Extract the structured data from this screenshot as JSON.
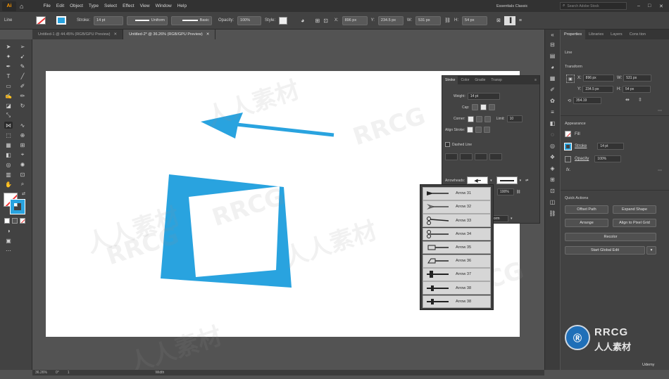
{
  "app": {
    "logo": "Ai",
    "workspace": "Essentials Classic",
    "search_placeholder": "Search Adobe Stock"
  },
  "menu": [
    "File",
    "Edit",
    "Object",
    "Type",
    "Select",
    "Effect",
    "View",
    "Window",
    "Help"
  ],
  "control_bar": {
    "stroke_label": "Stroke:",
    "stroke_value": "14 pt",
    "profile_value": "Uniform",
    "brush_value": "Basic",
    "opacity_label": "Opacity:",
    "opacity_value": "100%",
    "style_label": "Style:",
    "x_label": "X:",
    "x_value": "896 px",
    "y_label": "Y:",
    "y_value": "234.5 px",
    "w_label": "W:",
    "w_value": "531 px",
    "h_label": "H:",
    "h_value": "54 px",
    "line_label": "Line"
  },
  "tabs": [
    {
      "label": "Untitled-1 @ 44.45% (RGB/GPU Preview)",
      "active": false
    },
    {
      "label": "Untitled-2* @ 36.26% (RGB/GPU Preview)",
      "active": true
    }
  ],
  "stroke_panel": {
    "tabs": [
      "Stroke",
      "Color",
      "Gradie",
      "Transp"
    ],
    "weight_label": "Weight:",
    "weight_value": "14 pt",
    "cap_label": "Cap:",
    "corner_label": "Corner:",
    "limit_label": "Limit:",
    "limit_value": "10",
    "align_label": "Align Stroke:",
    "dashed_label": "Dashed Line",
    "arrowheads_label": "Arrowheads:",
    "scale_value": "100%",
    "profile_value": "Uniform"
  },
  "arrow_list": [
    "Arrow 31",
    "Arrow 32",
    "Arrow 33",
    "Arrow 34",
    "Arrow 35",
    "Arrow 36",
    "Arrow 37",
    "Arrow 38",
    "Arrow 38"
  ],
  "properties": {
    "tabs": [
      "Properties",
      "Libraries",
      "Layers",
      "Cons tion"
    ],
    "selection": "Line",
    "transform_label": "Transform",
    "x_label": "X:",
    "x_value": "896 px",
    "y_label": "Y:",
    "y_value": "234.5 px",
    "w_label": "W:",
    "w_value": "531 px",
    "h_label": "H:",
    "h_value": "54 px",
    "angle_value": "354.19",
    "appearance_label": "Appearance",
    "fill_label": "Fill",
    "stroke_label": "Stroke",
    "stroke_value": "14 pt",
    "opacity_label": "Opacity",
    "opacity_value": "100%",
    "fx_label": "fx.",
    "quick_actions_label": "Quick Actions",
    "quick_actions": [
      "Offset Path",
      "Expand Shape",
      "Arrange",
      "Align to Pixel Grid",
      "Recolor",
      "Start Global Edit"
    ]
  },
  "status": {
    "zoom": "36.26%",
    "rotation": "0°",
    "page": "1",
    "tool": "Width"
  },
  "colors": {
    "accent_blue": "#29a3df",
    "ui_dark": "#424242",
    "canvas": "#ffffff"
  },
  "watermark": {
    "text_cn": "人人素材",
    "text_en": "RRCG",
    "badge_en": "RRCG",
    "badge_cn": "人人素材"
  },
  "udemy": "Udemy"
}
